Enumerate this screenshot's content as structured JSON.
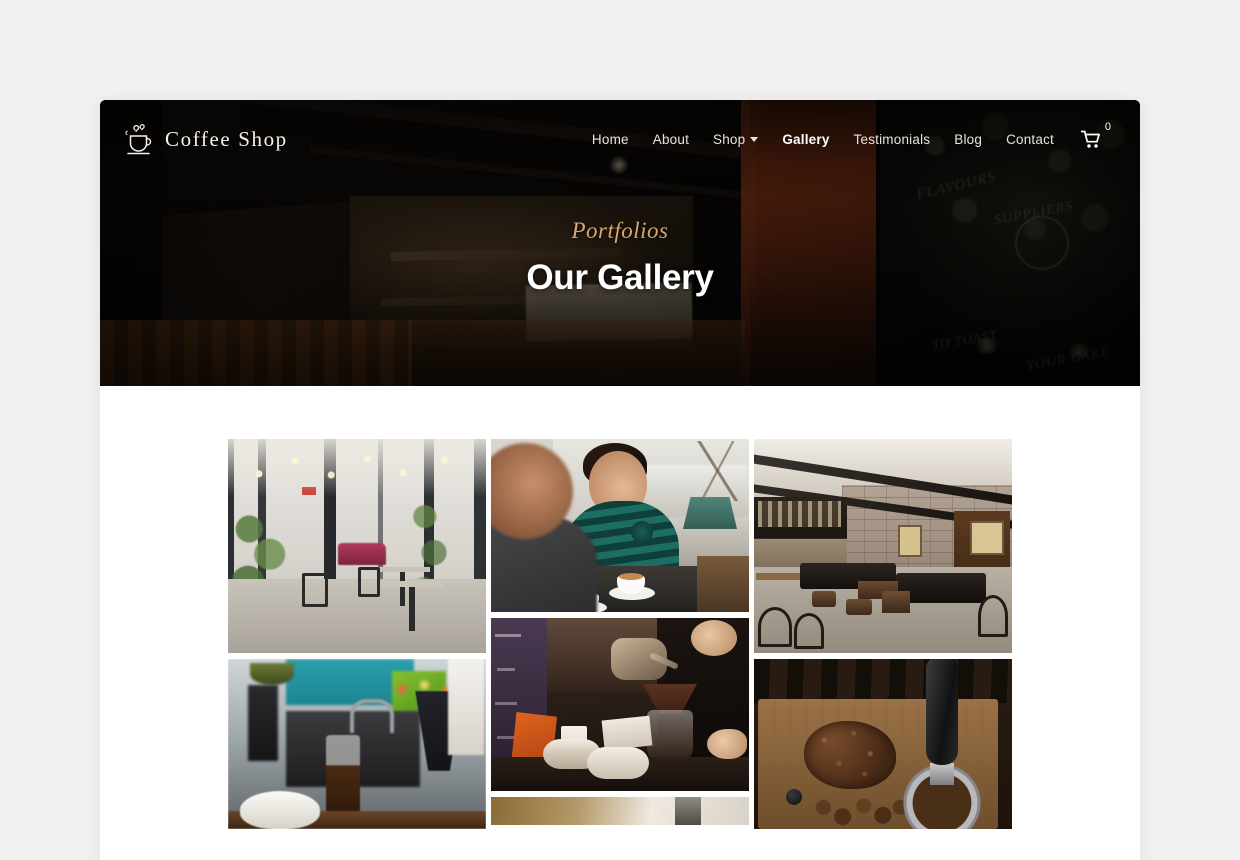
{
  "site": {
    "brand_name": "Coffee Shop",
    "logo_icon": "coffee-cup-icon"
  },
  "nav": {
    "items": [
      {
        "label": "Home",
        "active": false,
        "has_dropdown": false
      },
      {
        "label": "About",
        "active": false,
        "has_dropdown": false
      },
      {
        "label": "Shop",
        "active": false,
        "has_dropdown": true
      },
      {
        "label": "Gallery",
        "active": true,
        "has_dropdown": false
      },
      {
        "label": "Testimonials",
        "active": false,
        "has_dropdown": false
      },
      {
        "label": "Blog",
        "active": false,
        "has_dropdown": false
      },
      {
        "label": "Contact",
        "active": false,
        "has_dropdown": false
      }
    ],
    "cart": {
      "icon": "shopping-cart-icon",
      "count": "0"
    }
  },
  "hero": {
    "subtitle": "Portfolios",
    "title": "Our Gallery",
    "background_image": "coffee-shop-storefront-at-night",
    "subtitle_color": "#d9a86a",
    "title_color": "#ffffff"
  },
  "gallery": {
    "columns": 3,
    "items": [
      {
        "id": 1,
        "column": 1,
        "alt": "Bright cafe interior with open glass doors, string lights, plants and bistro tables",
        "size": "tall"
      },
      {
        "id": 5,
        "column": 1,
        "alt": "Blurred cafe counter with espresso machine, teal wall and coffee carafe",
        "size": "mid"
      },
      {
        "id": 2,
        "column": 2,
        "alt": "Woman in teal striped sweater talking with a man over coffee at a cafe table",
        "size": "short"
      },
      {
        "id": 4,
        "column": 2,
        "alt": "Pour over coffee brewing with gooseneck kettle, chalkboard menu and ceramic cups",
        "size": "short"
      },
      {
        "id": 7,
        "column": 2,
        "alt": "Partially visible cafe photo below the fold",
        "size": "clipped"
      },
      {
        "id": 3,
        "column": 3,
        "alt": "Industrial style cafe with exposed brick, skylights, leather sofas and bentwood chairs",
        "size": "tall"
      },
      {
        "id": 6,
        "column": 3,
        "alt": "Overhead view of ground coffee and portafilter on a wooden board",
        "size": "mid"
      }
    ]
  },
  "theme": {
    "page_background": "#f0f0f0",
    "content_background": "#ffffff",
    "accent": "#d9a86a"
  }
}
